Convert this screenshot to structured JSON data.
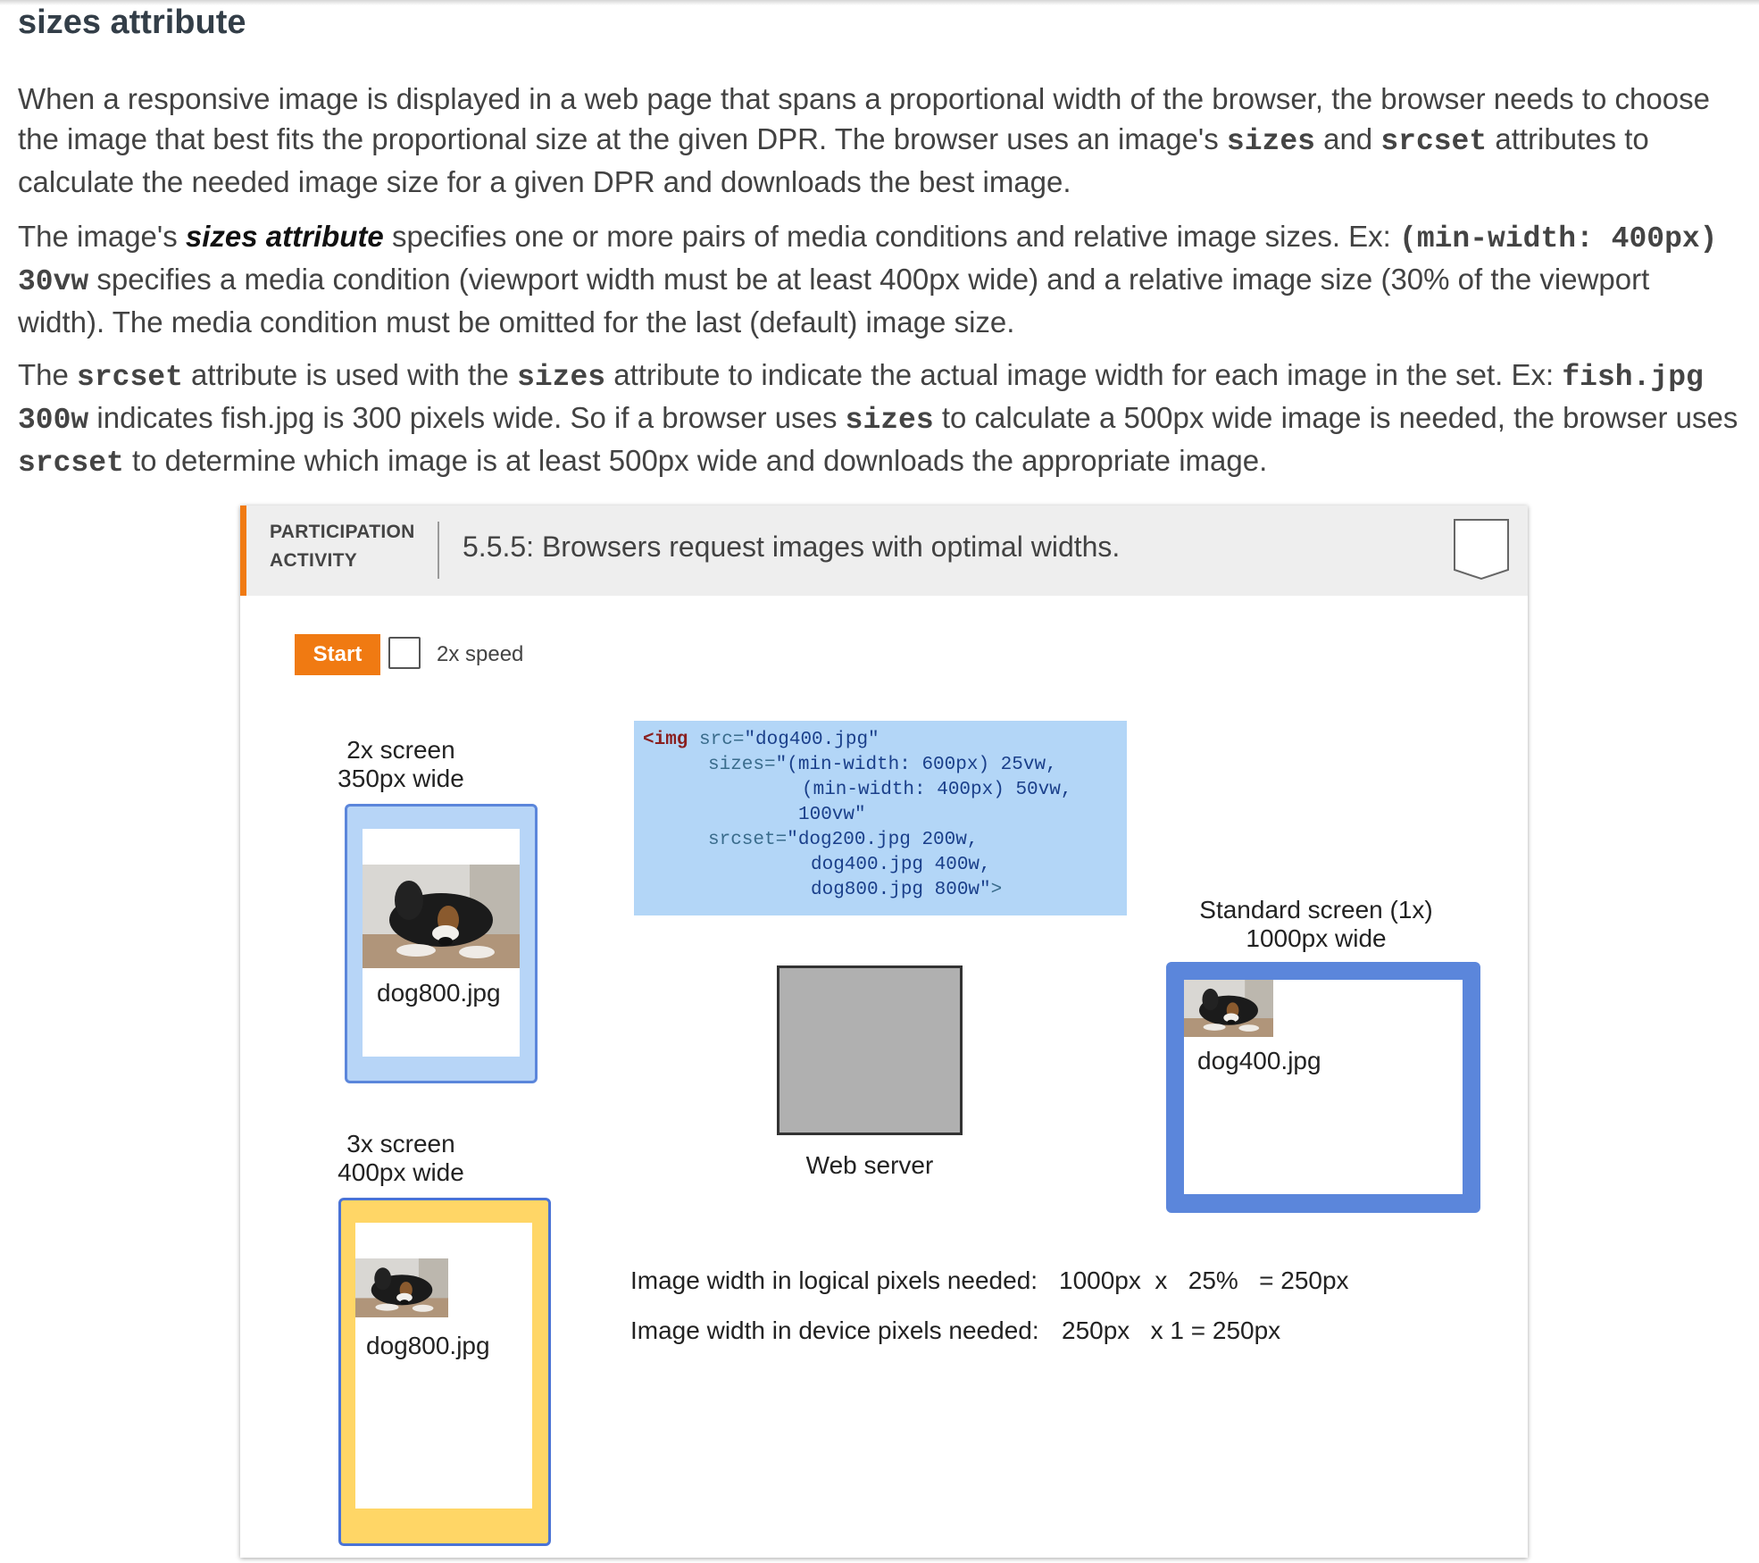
{
  "section_title": "sizes attribute",
  "p1": {
    "a": "When a responsive image is displayed in a web page that spans a proportional width of the browser, the browser needs to choose the image that best fits the proportional size at the given DPR. The browser uses an image's ",
    "code1": "sizes",
    "b": " and ",
    "code2": "srcset",
    "c": " attributes to calculate the needed image size for a given DPR and downloads the best image."
  },
  "p2": {
    "a": "The image's ",
    "em": "sizes attribute",
    "b": " specifies one or more pairs of media conditions and relative image sizes. Ex: ",
    "code": "(min-width: 400px) 30vw",
    "c": " specifies a media condition (viewport width must be at least 400px wide) and a relative image size (30% of the viewport width). The media condition must be omitted for the last (default) image size."
  },
  "p3": {
    "a": "The ",
    "code1": "srcset",
    "b": " attribute is used with the ",
    "code2": "sizes",
    "c": " attribute to indicate the actual image width for each image in the set. Ex: ",
    "code3": "fish.jpg 300w",
    "d": " indicates fish.jpg is 300 pixels wide. So if a browser uses ",
    "code4": "sizes",
    "e": " to calculate a 500px wide image is needed, the browser uses ",
    "code5": "srcset",
    "f": " to determine which image is at least 500px wide and downloads the appropriate image."
  },
  "activity": {
    "label_line1": "PARTICIPATION",
    "label_line2": "ACTIVITY",
    "title": "5.5.5: Browsers request images with optimal widths.",
    "start_label": "Start",
    "speed_label": "2x speed"
  },
  "screens": {
    "s2x": {
      "line1": "2x screen",
      "line2": "350px wide",
      "file": "dog800.jpg"
    },
    "s3x": {
      "line1": "3x screen",
      "line2": "400px wide",
      "file": "dog800.jpg"
    },
    "s1x": {
      "line1": "Standard screen (1x)",
      "line2": "1000px wide",
      "file": "dog400.jpg"
    }
  },
  "code": {
    "l1_tag": "<img",
    "l1_attr": " src=",
    "l1_val": "\"dog400.jpg\"",
    "l2_attr": "sizes=",
    "l2_val": "\"(min-width: 600px) 25vw,",
    "l3_val": "(min-width: 400px) 50vw,",
    "l4_val": "100vw\"",
    "l5_attr": "srcset=",
    "l5_val": "\"dog200.jpg 200w,",
    "l6_val": "dog400.jpg 400w,",
    "l7_val": "dog800.jpg 800w\"",
    "l7_end": ">"
  },
  "server_label": "Web server",
  "calc": {
    "logical_label": "Image width in logical pixels needed:",
    "logical_value": "1000px  x   25%   = 250px",
    "device_label": "Image width in device pixels needed:",
    "device_value": "250px   x 1 = 250px"
  },
  "colors": {
    "accent_orange": "#f07a12",
    "screen2x_border": "#5b86db",
    "screen2x_fill": "#b7d5f7",
    "screen3x_border": "#4a73d6",
    "screen3x_fill": "#ffd666",
    "screen1x_border": "#5b86db",
    "code_bg": "#b3d6f7",
    "server_fill": "#b0b0b0"
  }
}
